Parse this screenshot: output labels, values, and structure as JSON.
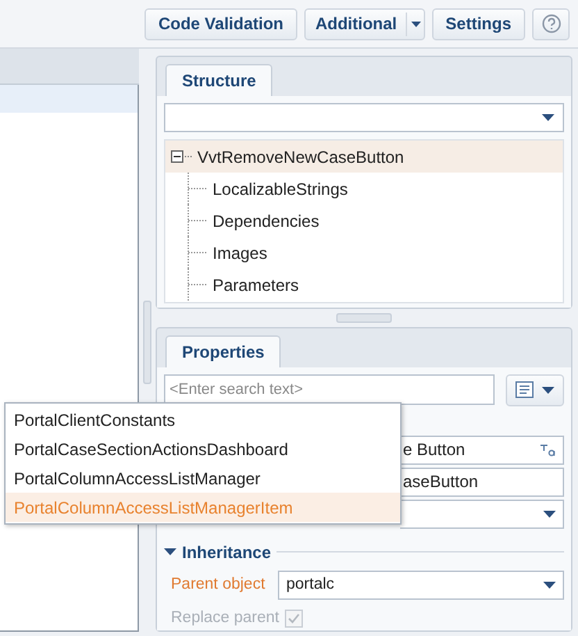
{
  "toolbar": {
    "buttons": [
      {
        "label": "Code Validation",
        "kind": "plain"
      },
      {
        "label": "Additional",
        "kind": "split"
      },
      {
        "label": "Settings",
        "kind": "plain"
      },
      {
        "kind": "help"
      }
    ]
  },
  "structure": {
    "tab": {
      "label": "Structure",
      "selected": true
    },
    "tree": [
      {
        "label": "VvtRemoveNewCaseButton",
        "expanded": true,
        "selected": true,
        "children": [
          {
            "label": "LocalizableStrings",
            "selected": false
          },
          {
            "label": "Dependencies",
            "selected": false
          },
          {
            "label": "Images",
            "selected": false
          },
          {
            "label": "Parameters",
            "selected": false
          }
        ]
      }
    ]
  },
  "properties": {
    "tab": {
      "label": "Properties",
      "selected": true
    },
    "search": {
      "placeholder": "<Enter search text>"
    },
    "fields": [
      {
        "kind": "text",
        "value": "e Button",
        "translate": true
      },
      {
        "kind": "text",
        "value": "aseButton",
        "translate": false
      },
      {
        "kind": "combo"
      }
    ],
    "inheritance": {
      "title": "Inheritance",
      "expanded": true,
      "parent_object": {
        "label": "Parent object",
        "value": "portalc"
      },
      "replace_parent": {
        "label": "Replace parent",
        "checked": true,
        "disabled": true
      }
    }
  },
  "suggestions": [
    {
      "label": "PortalClientConstants",
      "selected": false
    },
    {
      "label": "PortalCaseSectionActionsDashboard",
      "selected": false
    },
    {
      "label": "PortalColumnAccessListManager",
      "selected": false
    },
    {
      "label": "PortalColumnAccessListManagerItem",
      "selected": true
    }
  ]
}
